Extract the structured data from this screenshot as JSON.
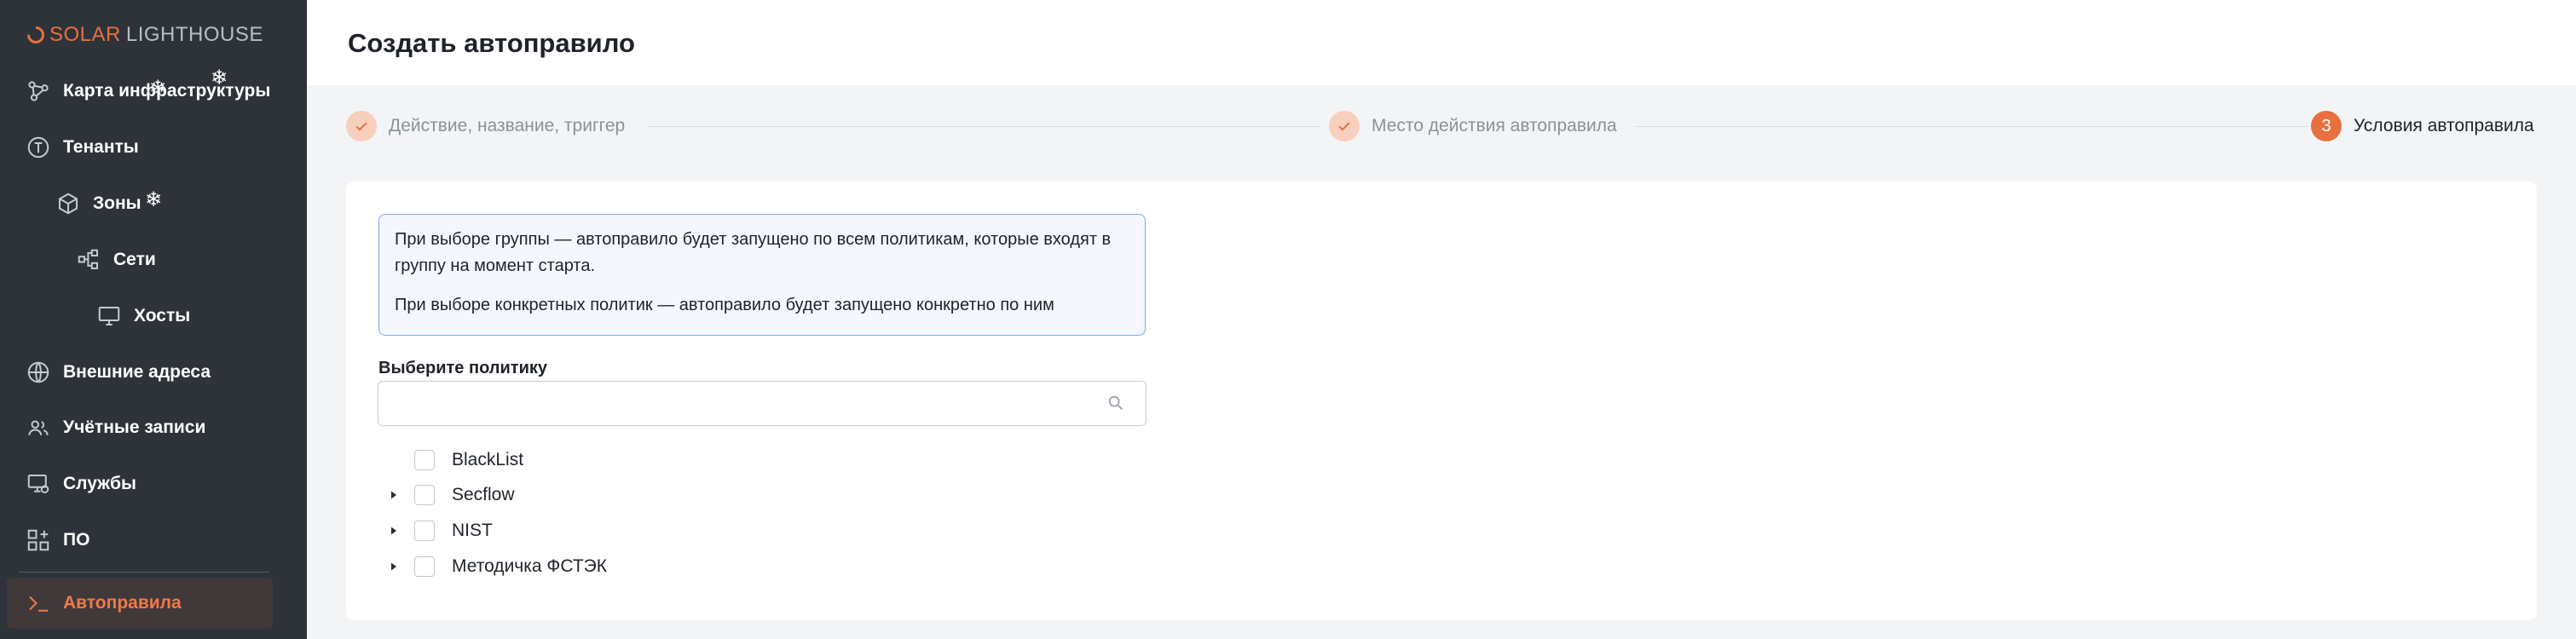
{
  "app": {
    "brand_primary": "SOLAR",
    "brand_secondary": "LIGHTHOUSE",
    "accent_color": "#e8703f"
  },
  "sidebar": {
    "items": [
      {
        "label": "Карта инфраструктуры",
        "icon": "network-map-icon"
      },
      {
        "label": "Тенанты",
        "icon": "tenant-icon"
      },
      {
        "label": "Зоны",
        "icon": "cube-icon"
      },
      {
        "label": "Сети",
        "icon": "network-icon"
      },
      {
        "label": "Хосты",
        "icon": "monitor-icon"
      },
      {
        "label": "Внешние адреса",
        "icon": "globe-icon"
      },
      {
        "label": "Учётные записи",
        "icon": "users-icon"
      },
      {
        "label": "Службы",
        "icon": "service-icon"
      },
      {
        "label": "ПО",
        "icon": "apps-icon"
      },
      {
        "label": "Автоправила",
        "icon": "terminal-icon",
        "active": true
      }
    ]
  },
  "header": {
    "title": "Создать автоправило"
  },
  "stepper": {
    "steps": [
      {
        "label": "Действие, название, триггер",
        "status": "done"
      },
      {
        "label": "Место действия автоправила",
        "status": "done"
      },
      {
        "label": "Условия автоправила",
        "status": "current",
        "number": "3"
      }
    ]
  },
  "form": {
    "info_lines": [
      "При выборе группы — автоправило будет запущено по всем политикам, которые входят в группу на момент старта.",
      "При выборе конкретных политик — автоправило будет запущено конкретно по ним"
    ],
    "policy_label": "Выберите политику",
    "search_placeholder": "",
    "search_value": "",
    "policies": [
      {
        "label": "BlackList",
        "expandable": false,
        "checked": false
      },
      {
        "label": "Secflow",
        "expandable": true,
        "checked": false
      },
      {
        "label": "NIST",
        "expandable": true,
        "checked": false
      },
      {
        "label": "Методичка ФСТЭК",
        "expandable": true,
        "checked": false
      }
    ]
  }
}
